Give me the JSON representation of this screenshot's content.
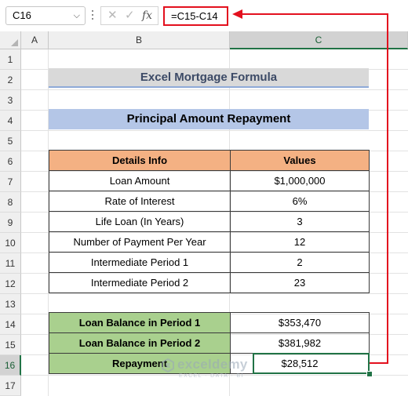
{
  "formula_bar": {
    "name_box": "C16",
    "name_box_chevron": "⌵",
    "cancel_glyph": "✕",
    "enter_glyph": "✓",
    "fx_label": "fx",
    "formula": "=C15-C14"
  },
  "columns": [
    "A",
    "B",
    "C"
  ],
  "rows": [
    "1",
    "2",
    "3",
    "4",
    "5",
    "6",
    "7",
    "8",
    "9",
    "10",
    "11",
    "12",
    "13",
    "14",
    "15",
    "16",
    "17"
  ],
  "selected_cell": "C16",
  "title": "Excel Mortgage Formula",
  "subtitle": "Principal Amount Repayment",
  "details_table": {
    "headers": [
      "Details Info",
      "Values"
    ],
    "rows": [
      [
        "Loan Amount",
        "$1,000,000"
      ],
      [
        "Rate of Interest",
        "6%"
      ],
      [
        "Life Loan (In Years)",
        "3"
      ],
      [
        "Number of Payment Per Year",
        "12"
      ],
      [
        "Intermediate Period 1",
        "2"
      ],
      [
        "Intermediate Period 2",
        "23"
      ]
    ]
  },
  "result_table": {
    "rows": [
      [
        "Loan Balance in Period 1",
        "$353,470"
      ],
      [
        "Loan Balance in Period 2",
        "$381,982"
      ],
      [
        "Repayment",
        "$28,512"
      ]
    ]
  },
  "watermark": {
    "name": "exceldemy",
    "tagline": "EXCEL · DATA · BI"
  },
  "colors": {
    "title_fill": "#d9d9d9",
    "subtitle_fill": "#b4c6e7",
    "header_fill": "#f4b183",
    "label_fill": "#a9d08e",
    "highlight": "#e3101e",
    "selection": "#217346"
  }
}
